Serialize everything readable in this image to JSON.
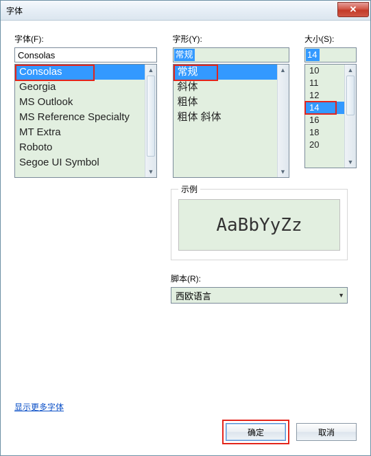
{
  "window": {
    "title": "字体"
  },
  "close": {
    "glyph": "✕"
  },
  "font": {
    "label": "字体(F):",
    "value": "Consolas",
    "items": [
      "Consolas",
      "Georgia",
      "MS Outlook",
      "MS Reference Specialty",
      "MT Extra",
      "Roboto",
      "Segoe UI Symbol"
    ],
    "selected_index": 0
  },
  "style": {
    "label": "字形(Y):",
    "value": "常规",
    "items": [
      "常规",
      "斜体",
      "粗体",
      "粗体 斜体"
    ],
    "selected_index": 0
  },
  "size": {
    "label": "大小(S):",
    "value": "14",
    "items": [
      "10",
      "11",
      "12",
      "14",
      "16",
      "18",
      "20"
    ],
    "selected_index": 3
  },
  "sample": {
    "label": "示例",
    "text": "AaBbYyZz"
  },
  "script": {
    "label": "脚本(R):",
    "value": "西欧语言"
  },
  "more_link": "显示更多字体",
  "buttons": {
    "ok": "确定",
    "cancel": "取消"
  },
  "scroll": {
    "up": "▲",
    "down": "▼"
  }
}
